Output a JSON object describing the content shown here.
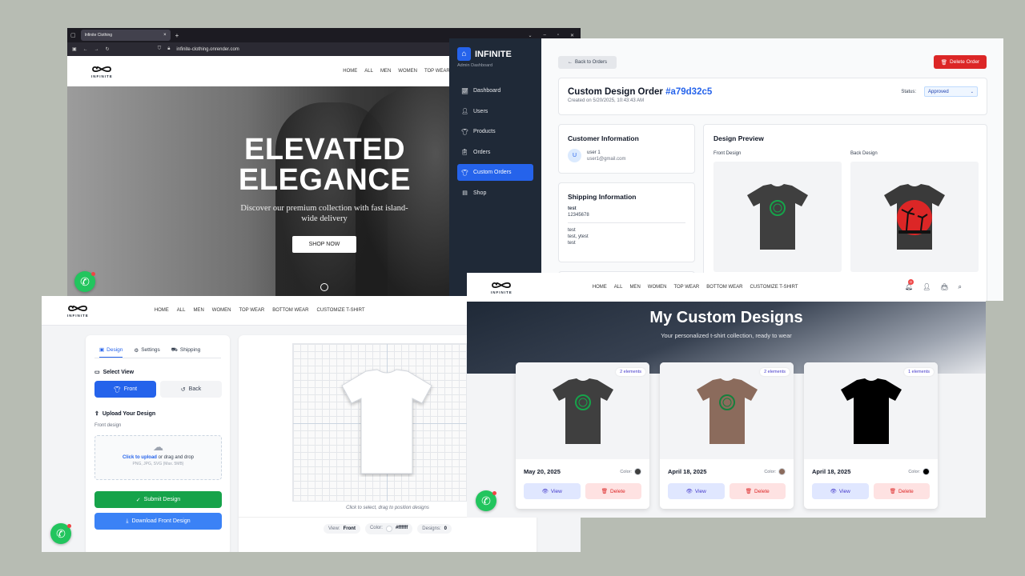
{
  "browser": {
    "tab_title": "Infinite Clothing",
    "url": "infinite-clothing.onrender.com"
  },
  "brand": {
    "logo_text": "INFINITE"
  },
  "nav": {
    "items": [
      "HOME",
      "ALL",
      "MEN",
      "WOMEN",
      "TOP WEAR",
      "BOTTOM WEAR",
      "CUSTOMIZE T-SHIRT"
    ]
  },
  "hero": {
    "title_line1": "ELEVATED",
    "title_line2": "ELEGANCE",
    "subtitle": "Discover our premium collection with fast island-wide delivery",
    "cta": "SHOP NOW"
  },
  "admin": {
    "brand": "INFINITE",
    "brand_sub": "Admin Dashboard",
    "menu": [
      {
        "label": "Dashboard",
        "icon": "chart-icon"
      },
      {
        "label": "Users",
        "icon": "user-icon"
      },
      {
        "label": "Products",
        "icon": "shirt-icon"
      },
      {
        "label": "Orders",
        "icon": "clipboard-icon"
      },
      {
        "label": "Custom Orders",
        "icon": "tshirt-icon"
      },
      {
        "label": "Shop",
        "icon": "store-icon"
      }
    ],
    "back_label": "Back to Orders",
    "delete_label": "Delete Order",
    "order_title": "Custom Design Order",
    "order_id": "#a79d32c5",
    "order_created": "Created on 5/20/2025, 10:43:43 AM",
    "status_label": "Status:",
    "status_value": "Approved",
    "customer": {
      "heading": "Customer Information",
      "avatar_letter": "U",
      "name": "user 1",
      "email": "user1@gmail.com"
    },
    "shipping": {
      "heading": "Shipping Information",
      "name": "test",
      "phone": "12345678",
      "address1": "test",
      "address2": "test, ytest",
      "address3": "test"
    },
    "preview": {
      "heading": "Design Preview",
      "front_label": "Front Design",
      "back_label": "Back Design"
    }
  },
  "designer": {
    "tabs": [
      "Design",
      "Settings",
      "Shipping"
    ],
    "select_view": "Select View",
    "front_btn": "Front",
    "back_btn": "Back",
    "upload_heading": "Upload Your Design",
    "upload_sub": "Front design",
    "upload_click": "Click to upload",
    "upload_rest": " or drag and drop",
    "upload_formats": "PNG, JPG, SVG (Max. 5MB)",
    "submit": "Submit Design",
    "download": "Download Front Design",
    "canvas_hint": "Click to select, drag to position designs",
    "pill_view_label": "View:",
    "pill_view_value": "Front",
    "pill_color_label": "Color:",
    "pill_color_value": "#ffffff",
    "pill_designs_label": "Designs:",
    "pill_designs_value": "0"
  },
  "my_designs": {
    "title": "My Custom Designs",
    "subtitle": "Your personalized t-shirt collection, ready to wear",
    "cart_count": "0",
    "cards": [
      {
        "tag": "2 elements",
        "date": "May 20, 2025",
        "color_label": "Color:",
        "color": "#3f3f3f",
        "view": "View",
        "delete": "Delete"
      },
      {
        "tag": "2 elements",
        "date": "April 18, 2025",
        "color_label": "Color:",
        "color": "#8b6b5c",
        "view": "View",
        "delete": "Delete"
      },
      {
        "tag": "1 elements",
        "date": "April 18, 2025",
        "color_label": "Color:",
        "color": "#000000",
        "view": "View",
        "delete": "Delete"
      }
    ]
  },
  "colors": {
    "accent_blue": "#2563eb",
    "danger_red": "#dc2626",
    "whatsapp_green": "#22c55e",
    "sidebar_dark": "#1f2937"
  }
}
